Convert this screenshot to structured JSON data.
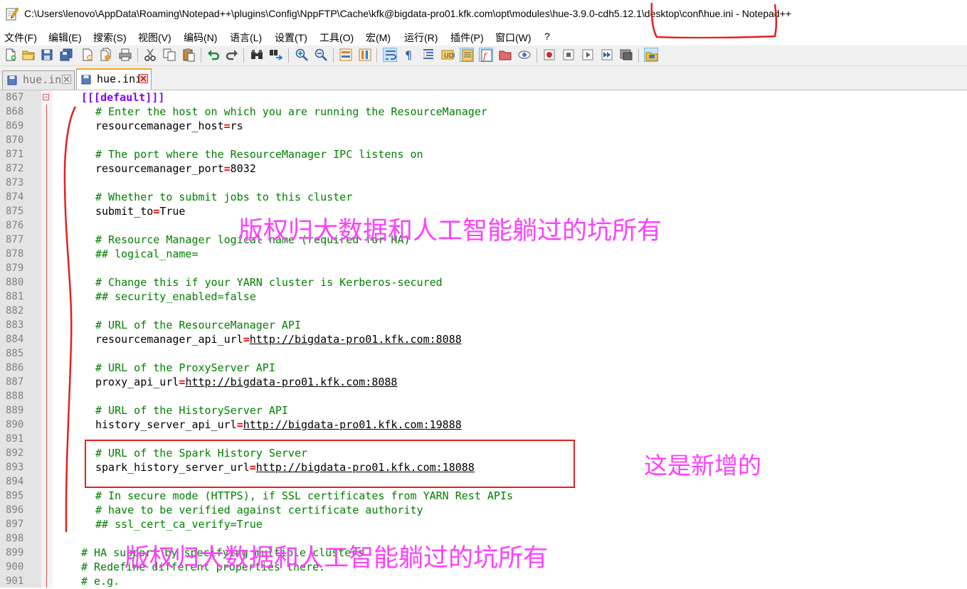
{
  "window": {
    "title": "C:\\Users\\lenovo\\AppData\\Roaming\\Notepad++\\plugins\\Config\\NppFTP\\Cache\\kfk@bigdata-pro01.kfk.com\\opt\\modules\\hue-3.9.0-cdh5.12.1\\desktop\\conf\\hue.ini - Notepad++"
  },
  "menu": [
    "文件(F)",
    "编辑(E)",
    "搜索(S)",
    "视图(V)",
    "编码(N)",
    "语言(L)",
    "设置(T)",
    "工具(O)",
    "宏(M)",
    "运行(R)",
    "插件(P)",
    "窗口(W)",
    "?"
  ],
  "toolbar_icons": [
    "new-file-icon",
    "open-file-icon",
    "save-icon",
    "save-all-icon",
    "close-icon",
    "close-all-icon",
    "print-icon",
    "cut-icon",
    "copy-icon",
    "paste-icon",
    "undo-icon",
    "redo-icon",
    "find-icon",
    "replace-icon",
    "zoom-in-icon",
    "zoom-out-icon",
    "sync-vertical-icon",
    "sync-horizontal-icon",
    "word-wrap-icon",
    "show-all-chars-icon",
    "indent-guide-icon",
    "user-lang-icon",
    "doc-map-icon",
    "function-list-icon",
    "folder-workspace-icon",
    "monitoring-icon",
    "record-macro-icon",
    "stop-macro-icon",
    "play-macro-icon",
    "run-macro-multiple-icon",
    "save-macro-icon",
    "nppftp-icon"
  ],
  "tabs": [
    {
      "label": "hue.ini",
      "active": false
    },
    {
      "label": "hue.ini",
      "active": true
    }
  ],
  "lines": [
    {
      "num": "867",
      "type": "section",
      "text": "[[[default]]]"
    },
    {
      "num": "868",
      "type": "comment",
      "text": "# Enter the host on which you are running the ResourceManager"
    },
    {
      "num": "869",
      "type": "kv",
      "key": "resourcemanager_host",
      "value": "rs",
      "url": false
    },
    {
      "num": "870",
      "type": "blank",
      "text": ""
    },
    {
      "num": "871",
      "type": "comment",
      "text": "# The port where the ResourceManager IPC listens on"
    },
    {
      "num": "872",
      "type": "kv",
      "key": "resourcemanager_port",
      "value": "8032",
      "url": false
    },
    {
      "num": "873",
      "type": "blank",
      "text": ""
    },
    {
      "num": "874",
      "type": "comment",
      "text": "# Whether to submit jobs to this cluster"
    },
    {
      "num": "875",
      "type": "kv",
      "key": "submit_to",
      "value": "True",
      "url": false
    },
    {
      "num": "876",
      "type": "blank",
      "text": ""
    },
    {
      "num": "877",
      "type": "comment",
      "text": "# Resource Manager logical name (required for HA)"
    },
    {
      "num": "878",
      "type": "comment",
      "text": "## logical_name="
    },
    {
      "num": "879",
      "type": "blank",
      "text": ""
    },
    {
      "num": "880",
      "type": "comment",
      "text": "# Change this if your YARN cluster is Kerberos-secured"
    },
    {
      "num": "881",
      "type": "comment",
      "text": "## security_enabled=false"
    },
    {
      "num": "882",
      "type": "blank",
      "text": ""
    },
    {
      "num": "883",
      "type": "comment",
      "text": "# URL of the ResourceManager API"
    },
    {
      "num": "884",
      "type": "kv",
      "key": "resourcemanager_api_url",
      "value": "http://bigdata-pro01.kfk.com:8088",
      "url": true
    },
    {
      "num": "885",
      "type": "blank",
      "text": ""
    },
    {
      "num": "886",
      "type": "comment",
      "text": "# URL of the ProxyServer API"
    },
    {
      "num": "887",
      "type": "kv",
      "key": "proxy_api_url",
      "value": "http://bigdata-pro01.kfk.com:8088",
      "url": true
    },
    {
      "num": "888",
      "type": "blank",
      "text": ""
    },
    {
      "num": "889",
      "type": "comment",
      "text": "# URL of the HistoryServer API"
    },
    {
      "num": "890",
      "type": "kv",
      "key": "history_server_api_url",
      "value": "http://bigdata-pro01.kfk.com:19888",
      "url": true
    },
    {
      "num": "891",
      "type": "blank",
      "text": ""
    },
    {
      "num": "892",
      "type": "comment",
      "text": "# URL of the Spark History Server"
    },
    {
      "num": "893",
      "type": "kv",
      "key": "spark_history_server_url",
      "value": "http://bigdata-pro01.kfk.com:18088",
      "url": true
    },
    {
      "num": "894",
      "type": "blank",
      "text": ""
    },
    {
      "num": "895",
      "type": "comment",
      "text": "# In secure mode (HTTPS), if SSL certificates from YARN Rest APIs"
    },
    {
      "num": "896",
      "type": "comment",
      "text": "# have to be verified against certificate authority"
    },
    {
      "num": "897",
      "type": "comment",
      "text": "## ssl_cert_ca_verify=True"
    },
    {
      "num": "898",
      "type": "blank",
      "text": ""
    },
    {
      "num": "899",
      "type": "comment-outer",
      "text": "# HA support by specifying multiple clusters"
    },
    {
      "num": "900",
      "type": "comment-outer",
      "text": "# Redefine different properties there."
    },
    {
      "num": "901",
      "type": "comment-outer",
      "text": "# e.g."
    }
  ],
  "annotations": {
    "watermark_1": "版权归大数据和人工智能躺过的坑所有",
    "watermark_2": "版权归大数据和人工智能躺过的坑所有",
    "new_label": "这是新增的"
  },
  "colors": {
    "comment": "#008000",
    "section": "#8000ff",
    "operator": "#ff0000",
    "annotation_pen": "#e32020",
    "watermark": "#ff40ff"
  }
}
